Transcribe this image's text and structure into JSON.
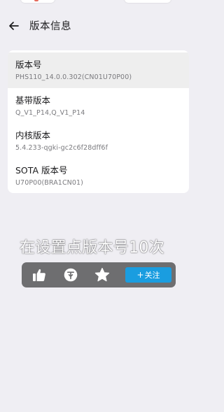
{
  "header": {
    "title": "版本信息"
  },
  "info": {
    "items": [
      {
        "label": "版本号",
        "value": "PHS110_14.0.0.302(CN01U70P00)"
      },
      {
        "label": "基带版本",
        "value": "Q_V1_P14,Q_V1_P14"
      },
      {
        "label": "内核版本",
        "value": "5.4.233-qgki-gc2c6f28dff6f"
      },
      {
        "label": "SOTA 版本号",
        "value": "U70P00(BRA1CN01)"
      }
    ]
  },
  "overlay": {
    "hint": "在设置点版本号10次",
    "follow_plus": "+",
    "follow_label": "关注"
  },
  "icons": {
    "back": "back-arrow-icon",
    "like": "thumbs-up-icon",
    "coin": "coin-icon",
    "favorite": "star-icon"
  },
  "colors": {
    "accent": "#1a9de0",
    "background": "#efeef3",
    "card": "#ffffff",
    "highlight": "#eeeeee",
    "action_bar": "#6e6e70"
  }
}
